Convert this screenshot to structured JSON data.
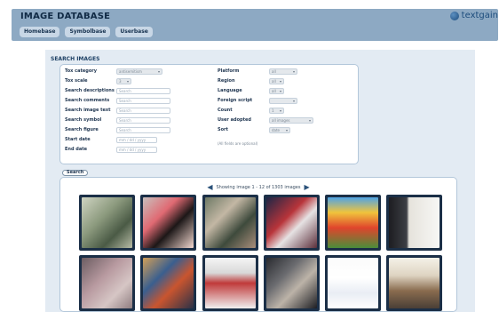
{
  "header": {
    "title": "IMAGE DATABASE",
    "logo_text": "textgain",
    "nav": [
      "Homebase",
      "Symbolbase",
      "Userbase"
    ]
  },
  "search": {
    "section_title": "SEARCH IMAGES",
    "left_fields": [
      {
        "label": "Tox category",
        "kind": "select",
        "value": "antisemitism"
      },
      {
        "label": "Tox scale",
        "kind": "select",
        "value": "3"
      },
      {
        "label": "Search descriptions",
        "kind": "input",
        "placeholder": "Search"
      },
      {
        "label": "Search comments",
        "kind": "input",
        "placeholder": "Search"
      },
      {
        "label": "Search image text",
        "kind": "input",
        "placeholder": "Search"
      },
      {
        "label": "Search symbol",
        "kind": "input",
        "placeholder": "Search"
      },
      {
        "label": "Search figure",
        "kind": "input",
        "placeholder": "Search"
      },
      {
        "label": "Start date",
        "kind": "date",
        "placeholder": "mm / dd / yyyy"
      },
      {
        "label": "End date",
        "kind": "date",
        "placeholder": "mm / dd / yyyy"
      }
    ],
    "right_fields": [
      {
        "label": "Platform",
        "kind": "select",
        "value": "all"
      },
      {
        "label": "Region",
        "kind": "select",
        "value": "all"
      },
      {
        "label": "Language",
        "kind": "select",
        "value": "all"
      },
      {
        "label": "Foreign script",
        "kind": "select",
        "value": ""
      },
      {
        "label": "Count",
        "kind": "select",
        "value": "1"
      },
      {
        "label": "User adopted",
        "kind": "select",
        "value": "all images"
      },
      {
        "label": "Sort",
        "kind": "select",
        "value": "date"
      }
    ],
    "hint": "(All fields are optional)",
    "button_label": "Search"
  },
  "results": {
    "pager_text": "Showing image 1 - 12 of 1303 images",
    "thumbnails": [
      {
        "name": "photo-soldiers",
        "fill": "linear-gradient(135deg,#cfd4c2 0%,#8c9a7e 40%,#4a5a45 70%,#b8bca6 100%)"
      },
      {
        "name": "cartoon-face-red",
        "fill": "linear-gradient(135deg,#c9c0bd 0%,#e06a73 35%,#1c1717 60%,#f2d7cf 100%)"
      },
      {
        "name": "blurred-figure",
        "fill": "linear-gradient(135deg,#6e7a66 0%,#c3b7a4 35%,#3e4a3c 65%,#a98e7b 100%)"
      },
      {
        "name": "group-costumes",
        "fill": "linear-gradient(135deg,#1d2646 0%,#b8343a 40%,#e6e2e3 60%,#5b2e3a 100%)"
      },
      {
        "name": "mario-israel-game",
        "fill": "linear-gradient(180deg,#4fa4e6 0%,#f0c43c 30%,#e0452c 60%,#4b8e3a 100%)"
      },
      {
        "name": "text-quote-portrait",
        "fill": "linear-gradient(90deg,#1d1d21 0%,#3c3e44 35%,#e6e3dc 40%,#f7f7f5 100%)"
      },
      {
        "name": "blurred-portrait",
        "fill": "linear-gradient(135deg,#6c5d62 0%,#b89aa0 40%,#d6c6c5 70%,#8f7d80 100%)"
      },
      {
        "name": "painted-scene",
        "fill": "linear-gradient(135deg,#d29f58 0%,#3a5f8f 35%,#c9552f 60%,#2b3147 100%)"
      },
      {
        "name": "comic-panels",
        "fill": "linear-gradient(180deg,#f5f5f5 0%,#d8d8d8 30%,#c03a3a 50%,#f0f0f0 100%)"
      },
      {
        "name": "dark-portrait",
        "fill": "linear-gradient(135deg,#2a2b30 0%,#6b6c70 35%,#bcb3a8 60%,#1c1d22 100%)"
      },
      {
        "name": "wojak-sketch",
        "fill": "linear-gradient(180deg,#fbfbfb 0%,#ffffff 40%,#e9edf4 70%,#ffffff 100%)"
      },
      {
        "name": "text-collage",
        "fill": "linear-gradient(180deg,#f4f1e8 0%,#ded4c1 35%,#8a6c4f 65%,#4a3f36 100%)"
      }
    ]
  },
  "colors": {
    "header_bg": "#8da9c3",
    "page_bg": "#e3ebf3",
    "accent": "#1e4d7d"
  }
}
